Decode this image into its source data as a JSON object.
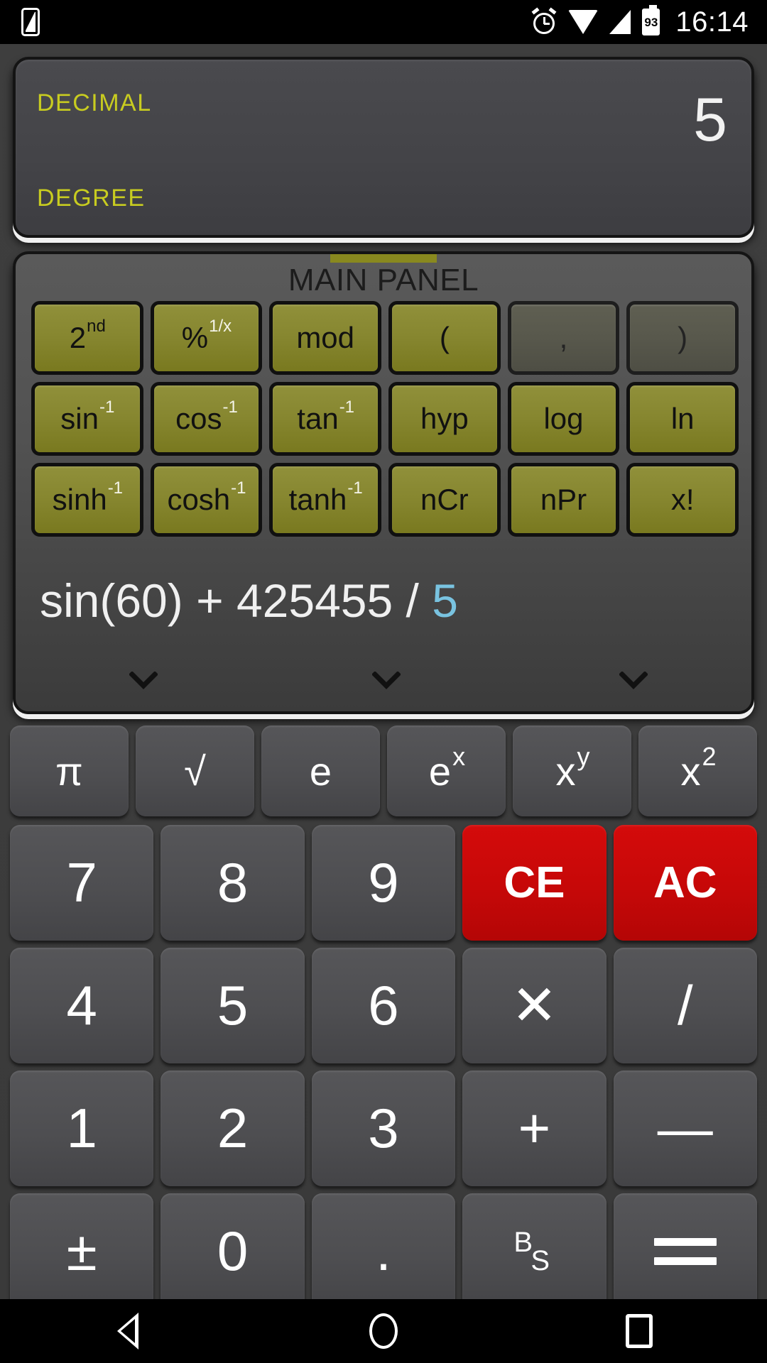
{
  "statusbar": {
    "sim_icon": "sim-card-icon",
    "alarm_icon": "alarm-clock-icon",
    "wifi_icon": "wifi-icon",
    "signal_icon": "cellular-signal-icon",
    "battery_icon": "battery-icon",
    "battery_level": "93",
    "time": "16:14"
  },
  "display": {
    "base_mode": "DECIMAL",
    "angle_mode": "DEGREE",
    "value": "5",
    "label_color": "#c8cc20",
    "value_color": "#f2f2f2"
  },
  "main_panel": {
    "title": "MAIN PANEL",
    "tab_color": "#89891f",
    "function_keys": [
      {
        "label": "2",
        "sup": "nd",
        "sup_color": "dark",
        "disabled": false,
        "name": "second-function-button"
      },
      {
        "label": "%",
        "sup": "1/x",
        "sup_color": "light",
        "disabled": false,
        "name": "percent-button"
      },
      {
        "label": "mod",
        "sup": "",
        "sup_color": "",
        "disabled": false,
        "name": "mod-button"
      },
      {
        "label": "(",
        "sup": "",
        "sup_color": "",
        "disabled": false,
        "name": "open-paren-button"
      },
      {
        "label": ",",
        "sup": "",
        "sup_color": "",
        "disabled": true,
        "name": "comma-button"
      },
      {
        "label": ")",
        "sup": "",
        "sup_color": "",
        "disabled": true,
        "name": "close-paren-button"
      },
      {
        "label": "sin",
        "sup": "-1",
        "sup_color": "light",
        "disabled": false,
        "name": "sin-button"
      },
      {
        "label": "cos",
        "sup": "-1",
        "sup_color": "light",
        "disabled": false,
        "name": "cos-button"
      },
      {
        "label": "tan",
        "sup": "-1",
        "sup_color": "light",
        "disabled": false,
        "name": "tan-button"
      },
      {
        "label": "hyp",
        "sup": "",
        "sup_color": "",
        "disabled": false,
        "name": "hyp-button"
      },
      {
        "label": "log",
        "sup": "",
        "sup_color": "",
        "disabled": false,
        "name": "log-button"
      },
      {
        "label": "ln",
        "sup": "",
        "sup_color": "",
        "disabled": false,
        "name": "ln-button"
      },
      {
        "label": "sinh",
        "sup": "-1",
        "sup_color": "light",
        "disabled": false,
        "name": "sinh-button"
      },
      {
        "label": "cosh",
        "sup": "-1",
        "sup_color": "light",
        "disabled": false,
        "name": "cosh-button"
      },
      {
        "label": "tanh",
        "sup": "-1",
        "sup_color": "light",
        "disabled": false,
        "name": "tanh-button"
      },
      {
        "label": "nCr",
        "sup": "",
        "sup_color": "",
        "disabled": false,
        "name": "ncr-button"
      },
      {
        "label": "nPr",
        "sup": "",
        "sup_color": "",
        "disabled": false,
        "name": "npr-button"
      },
      {
        "label": "x!",
        "sup": "",
        "sup_color": "",
        "disabled": false,
        "name": "factorial-button"
      }
    ],
    "expression_prefix": "sin(60) + 425455 / ",
    "expression_cursor": "5",
    "cursor_color": "#79c3e0",
    "chevron_icon": "chevron-down-icon"
  },
  "keypad": {
    "row_top": [
      {
        "label": "π",
        "sup": "",
        "name": "pi-button"
      },
      {
        "label": "√",
        "sup": "",
        "name": "sqrt-button"
      },
      {
        "label": "e",
        "sup": "",
        "name": "e-button"
      },
      {
        "label": "e",
        "sup": "x",
        "name": "e-power-x-button"
      },
      {
        "label": "x",
        "sup": "y",
        "name": "x-power-y-button"
      },
      {
        "label": "x",
        "sup": "2",
        "name": "x-squared-button"
      }
    ],
    "rows": [
      [
        {
          "label": "7",
          "style": "digit",
          "name": "digit-7-button"
        },
        {
          "label": "8",
          "style": "digit",
          "name": "digit-8-button"
        },
        {
          "label": "9",
          "style": "digit",
          "name": "digit-9-button"
        },
        {
          "label": "CE",
          "style": "red",
          "name": "clear-entry-button"
        },
        {
          "label": "AC",
          "style": "red",
          "name": "all-clear-button"
        }
      ],
      [
        {
          "label": "4",
          "style": "digit",
          "name": "digit-4-button"
        },
        {
          "label": "5",
          "style": "digit",
          "name": "digit-5-button"
        },
        {
          "label": "6",
          "style": "digit",
          "name": "digit-6-button"
        },
        {
          "label": "✕",
          "style": "op",
          "name": "multiply-button"
        },
        {
          "label": "/",
          "style": "op",
          "name": "divide-button"
        }
      ],
      [
        {
          "label": "1",
          "style": "digit",
          "name": "digit-1-button"
        },
        {
          "label": "2",
          "style": "digit",
          "name": "digit-2-button"
        },
        {
          "label": "3",
          "style": "digit",
          "name": "digit-3-button"
        },
        {
          "label": "+",
          "style": "op",
          "name": "add-button"
        },
        {
          "label": "—",
          "style": "op",
          "name": "subtract-button"
        }
      ],
      [
        {
          "label": "±",
          "style": "op",
          "name": "sign-toggle-button"
        },
        {
          "label": "0",
          "style": "digit",
          "name": "digit-0-button"
        },
        {
          "label": ".",
          "style": "digit",
          "name": "decimal-point-button"
        },
        {
          "label": "BS",
          "style": "backspace",
          "name": "backspace-button"
        },
        {
          "label": "=",
          "style": "equals",
          "name": "equals-button"
        }
      ]
    ],
    "backspace_top": "B",
    "backspace_bottom": "S"
  },
  "navbar": {
    "back": "back-icon",
    "home": "home-icon",
    "recents": "recents-icon"
  }
}
